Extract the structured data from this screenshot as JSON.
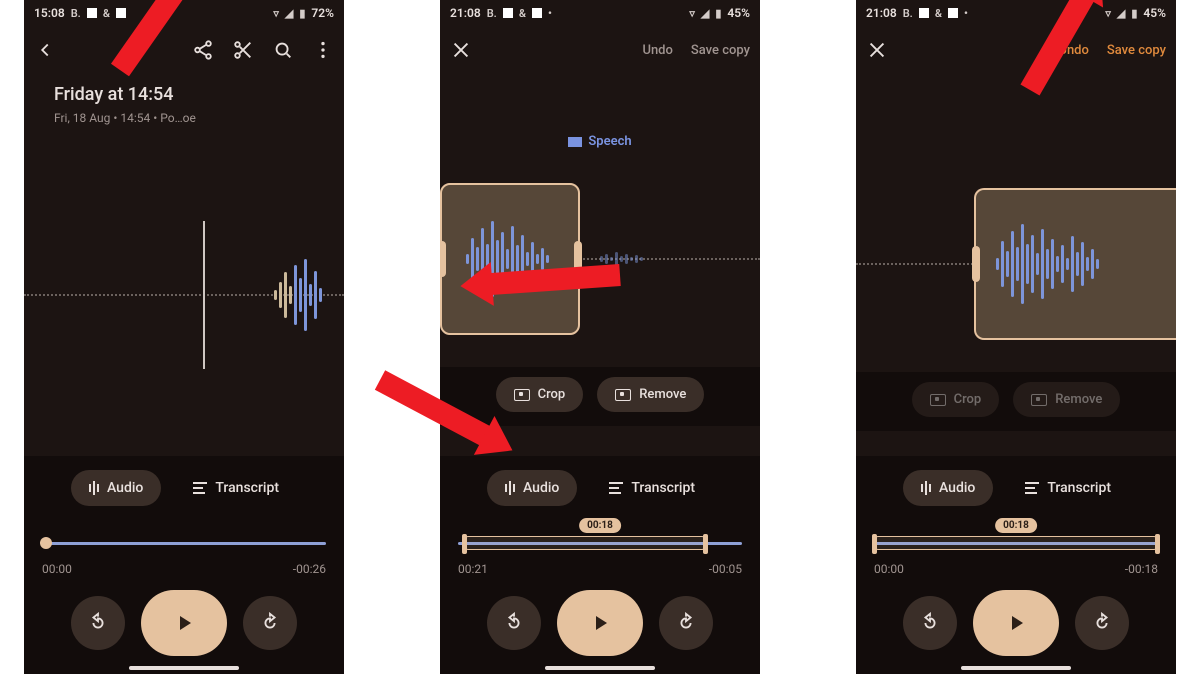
{
  "screens": [
    {
      "status": {
        "time": "15:08",
        "battery": "72%"
      },
      "topbar": {
        "mode": "view"
      },
      "title": "Friday at 14:54",
      "subtitle": "Fri, 18 Aug • 14:54 • Po…oe",
      "tabs": {
        "audio": "Audio",
        "transcript": "Transcript"
      },
      "times": {
        "start": "00:00",
        "end": "-00:26"
      }
    },
    {
      "status": {
        "time": "21:08",
        "battery": "45%"
      },
      "topbar": {
        "undo": "Undo",
        "save": "Save copy",
        "save_orange": false
      },
      "speech_chip": "Speech",
      "crop": {
        "crop": "Crop",
        "remove": "Remove",
        "enabled": true
      },
      "tabs": {
        "audio": "Audio",
        "transcript": "Transcript"
      },
      "badge": "00:18",
      "times": {
        "start": "00:21",
        "end": "-00:05"
      }
    },
    {
      "status": {
        "time": "21:08",
        "battery": "45%"
      },
      "topbar": {
        "undo": "Undo",
        "save": "Save copy",
        "save_orange": true
      },
      "crop": {
        "crop": "Crop",
        "remove": "Remove",
        "enabled": false
      },
      "tabs": {
        "audio": "Audio",
        "transcript": "Transcript"
      },
      "badge": "00:18",
      "times": {
        "start": "00:00",
        "end": "-00:18"
      }
    }
  ]
}
